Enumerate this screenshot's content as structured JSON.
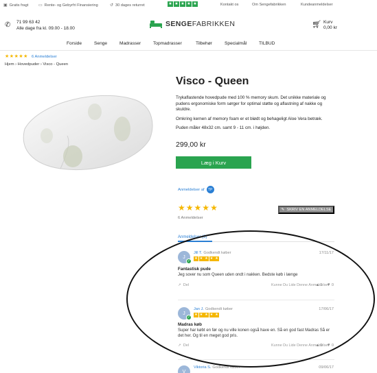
{
  "topbar": {
    "shipping": "Gratis fragt",
    "financing": "Rente- og Gebyrfri Finansiering",
    "returns": "30 dages returret",
    "trust_stars": 5,
    "contact": "Kontakt os",
    "about": "Om Sengefabrikken",
    "customer_reviews": "Kundeanmeldelser"
  },
  "header": {
    "phone": "71 99 63 42",
    "hours": "Alle dage fra kl. 09.00 - 18.00",
    "logo_bold": "SENGE",
    "logo_rest": "FABRIKKEN",
    "cart_label": "Kurv",
    "cart_amount": "0,00 kr"
  },
  "nav": [
    "Forside",
    "Senge",
    "Madrasser",
    "Topmadrasser",
    "Tilbehør",
    "Specialmål",
    "TILBUD"
  ],
  "rating_summary": {
    "stars": 5,
    "count_text": "6 Anmeldelser"
  },
  "breadcrumb": "Hjem › Hovedpuder › Visco - Queen",
  "product": {
    "title": "Visco - Queen",
    "desc1": "Trykaflastende hovedpude med 100 % memory skum. Det unikke materiale og pudens ergonomiske form sørger for optimal støtte og aflastning af nakke og skuldre.",
    "desc2": "Omkring kernen af memory foam er et blødt og behageligt Aloe Vera betræk.",
    "desc3": "Puden måler 48x32 cm. samt 9 - 11 cm. i højden.",
    "price": "299,00 kr",
    "add_to_cart": "Læg i Kurv"
  },
  "reviews_widget": {
    "reviews_by": "Anmeldelser af",
    "badge": "TP",
    "stars": 5,
    "count_text": "6 Anmeldelser",
    "write_review": "SKRIV EN ANMELDELSE",
    "tab": "Anmeldelser (6)",
    "share": "Del",
    "helpful": "Kunne Du Lide Denne Anmeldelse?",
    "verified": "Godkendt køber",
    "items": [
      {
        "initial": "J",
        "name": "Jill T.",
        "date": "17/11/17",
        "title": "Fantastisk pude",
        "body": "Jeg sover nu som Queen uden ondt i nakken. Bedste køb i længe",
        "up": "1",
        "down": "0"
      },
      {
        "initial": "J",
        "name": "Jan J.",
        "date": "17/06/17",
        "title": "Madras køb",
        "body": "Super har købt en før og nu ville konen også have en. Så en god fast Madras Så er det her. Og til en meget god pris.",
        "up": "0",
        "down": "0"
      },
      {
        "initial": "V",
        "name": "Viktoria S.",
        "date": "09/06/17"
      }
    ]
  }
}
